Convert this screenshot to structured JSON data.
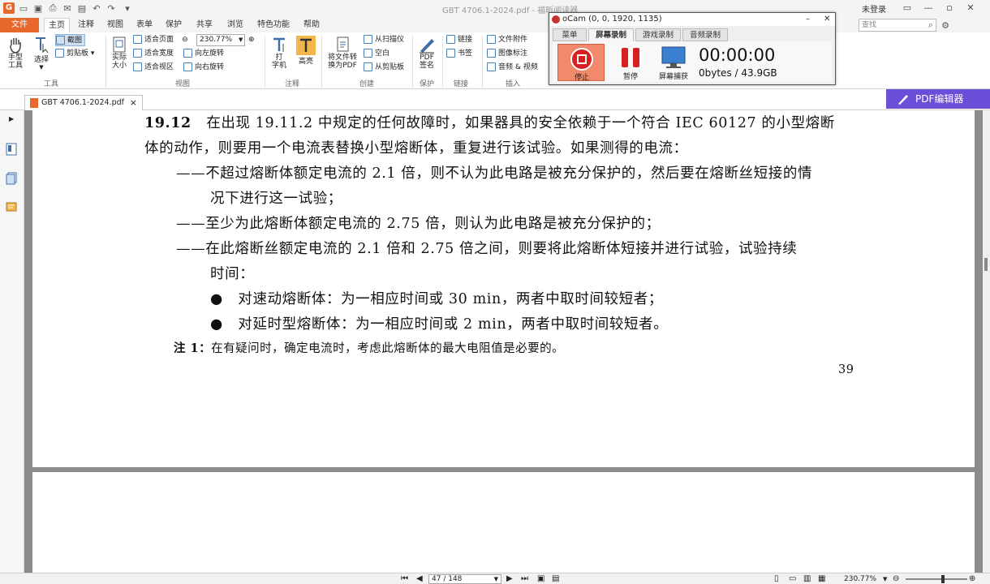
{
  "window": {
    "title": "GBT 4706.1-2024.pdf - 福昕阅读器",
    "login": "未登录",
    "search_placeholder": "查找"
  },
  "menu": {
    "file": "文件",
    "tabs": [
      "主页",
      "注释",
      "视图",
      "表单",
      "保护",
      "共享",
      "浏览",
      "特色功能",
      "帮助"
    ]
  },
  "ribbon": {
    "hand_tool": "手型\n工具",
    "select": "选择",
    "screenshot": "截图",
    "clipboard": "剪贴板",
    "group_tools": "工具",
    "actual_size": "实际\n大小",
    "fit_page": "适合页面",
    "fit_width": "适合宽度",
    "fit_view": "适合视区",
    "zoom_value": "230.77%",
    "rotate_left": "向左旋转",
    "rotate_right": "向右旋转",
    "group_view": "视图",
    "typewriter": "打\n字机",
    "highlight": "高亮",
    "group_comment": "注释",
    "convert_pdf": "将文件转\n换为PDF",
    "from_scanner": "从扫描仪",
    "blank": "空白",
    "from_clipboard": "从剪贴板",
    "group_create": "创建",
    "pdf_sign": "PDF\n签名",
    "group_protect": "保护",
    "link": "链接",
    "bookmark": "书签",
    "group_link": "链接",
    "file_attach": "文件附件",
    "image_annot": "图像标注",
    "audio_video": "音频 & 视频",
    "group_insert": "插入"
  },
  "doc_tab": {
    "name": "GBT 4706.1-2024.pdf",
    "close": "×"
  },
  "pdf_editor": "PDF编辑器",
  "document": {
    "section_num": "19.12",
    "line1": "在出现 19.11.2 中规定的任何故障时，如果器具的安全依赖于一个符合 IEC 60127 的小型熔断",
    "line2": "体的动作，则要用一个电流表替换小型熔断体，重复进行该试验。如果测得的电流：",
    "line3": "——不超过熔断体额定电流的 2.1 倍，则不认为此电路是被充分保护的，然后要在熔断丝短接的情",
    "line4": "况下进行这一试验；",
    "line5": "——至少为此熔断体额定电流的 2.75 倍，则认为此电路是被充分保护的；",
    "line6": "——在此熔断丝额定电流的 2.1 倍和 2.75 倍之间，则要将此熔断体短接并进行试验，试验持续",
    "line7": "时间：",
    "bullet": "●",
    "bullet1": "对速动熔断体：为一相应时间或 30 min，两者中取时间较短者；",
    "bullet2": "对延时型熔断体：为一相应时间或 2 min，两者中取时间较短者。",
    "note_label": "注 1：",
    "note_text": "在有疑问时，确定电流时，考虑此熔断体的最大电阻值是必要的。",
    "page_number": "39"
  },
  "statusbar": {
    "page": "47 / 148",
    "zoom": "230.77%"
  },
  "ocam": {
    "title": "oCam (0, 0, 1920, 1135)",
    "tabs": [
      "菜单",
      "屏幕录制",
      "游戏录制",
      "音频录制"
    ],
    "stop": "停止",
    "pause": "暂停",
    "capture": "屏幕捕获",
    "timer": "00:00:00",
    "size": "0bytes / 43.9GB"
  }
}
